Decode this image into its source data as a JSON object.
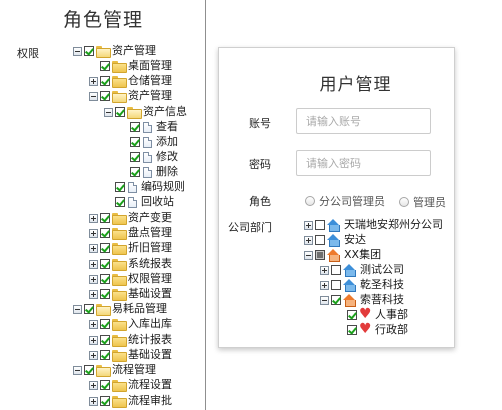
{
  "role_panel": {
    "title": "角色管理",
    "perm_label": "权限",
    "tree": [
      {
        "label": "资产管理",
        "expander": "minus",
        "check": "on",
        "icon": "folder-open"
      },
      {
        "label": "桌面管理",
        "expander": "none",
        "check": "on",
        "icon": "folder"
      },
      {
        "label": "仓储管理",
        "expander": "plus",
        "check": "on",
        "icon": "folder"
      },
      {
        "label": "资产管理",
        "expander": "minus",
        "check": "on",
        "icon": "folder-open"
      },
      {
        "label": "资产信息",
        "expander": "minus",
        "check": "on",
        "icon": "folder-open"
      },
      {
        "label": "查看",
        "expander": "none",
        "check": "on",
        "icon": "doc"
      },
      {
        "label": "添加",
        "expander": "none",
        "check": "on",
        "icon": "doc"
      },
      {
        "label": "修改",
        "expander": "none",
        "check": "on",
        "icon": "doc"
      },
      {
        "label": "删除",
        "expander": "none",
        "check": "on",
        "icon": "doc"
      },
      {
        "label": "编码规则",
        "expander": "none",
        "check": "on",
        "icon": "doc"
      },
      {
        "label": "回收站",
        "expander": "none",
        "check": "on",
        "icon": "doc"
      },
      {
        "label": "资产变更",
        "expander": "plus",
        "check": "on",
        "icon": "folder"
      },
      {
        "label": "盘点管理",
        "expander": "plus",
        "check": "on",
        "icon": "folder"
      },
      {
        "label": "折旧管理",
        "expander": "plus",
        "check": "on",
        "icon": "folder"
      },
      {
        "label": "系统报表",
        "expander": "plus",
        "check": "on",
        "icon": "folder"
      },
      {
        "label": "权限管理",
        "expander": "plus",
        "check": "on",
        "icon": "folder"
      },
      {
        "label": "基础设置",
        "expander": "plus",
        "check": "on",
        "icon": "folder"
      },
      {
        "label": "易耗品管理",
        "expander": "minus",
        "check": "on",
        "icon": "folder-open"
      },
      {
        "label": "入库出库",
        "expander": "plus",
        "check": "on",
        "icon": "folder"
      },
      {
        "label": "统计报表",
        "expander": "plus",
        "check": "on",
        "icon": "folder"
      },
      {
        "label": "基础设置",
        "expander": "plus",
        "check": "on",
        "icon": "folder"
      },
      {
        "label": "流程管理",
        "expander": "minus",
        "check": "on",
        "icon": "folder-open"
      },
      {
        "label": "流程设置",
        "expander": "plus",
        "check": "on",
        "icon": "folder"
      },
      {
        "label": "流程审批",
        "expander": "plus",
        "check": "on",
        "icon": "folder"
      }
    ]
  },
  "user_form": {
    "title": "用户管理",
    "account_label": "账号",
    "account_placeholder": "请输入账号",
    "password_label": "密码",
    "password_placeholder": "请输入密码",
    "role_label": "角色",
    "role_options": [
      "分公司管理员",
      "管理员"
    ],
    "dept_label": "公司部门",
    "dept_tree": [
      {
        "label": "天瑞地安郑州分公司",
        "expander": "plus",
        "check": "off",
        "icon": "house"
      },
      {
        "label": "安达",
        "expander": "plus",
        "check": "off",
        "icon": "house"
      },
      {
        "label": "XX集团",
        "expander": "minus",
        "check": "part",
        "icon": "house-orange"
      },
      {
        "label": "测试公司",
        "expander": "plus",
        "check": "off",
        "icon": "house"
      },
      {
        "label": "乾圣科技",
        "expander": "plus",
        "check": "off",
        "icon": "house"
      },
      {
        "label": "索菩科技",
        "expander": "minus",
        "check": "on",
        "icon": "house-orange"
      },
      {
        "label": "人事部",
        "expander": "none",
        "check": "on",
        "icon": "heart"
      },
      {
        "label": "行政部",
        "expander": "none",
        "check": "on",
        "icon": "heart"
      }
    ]
  }
}
